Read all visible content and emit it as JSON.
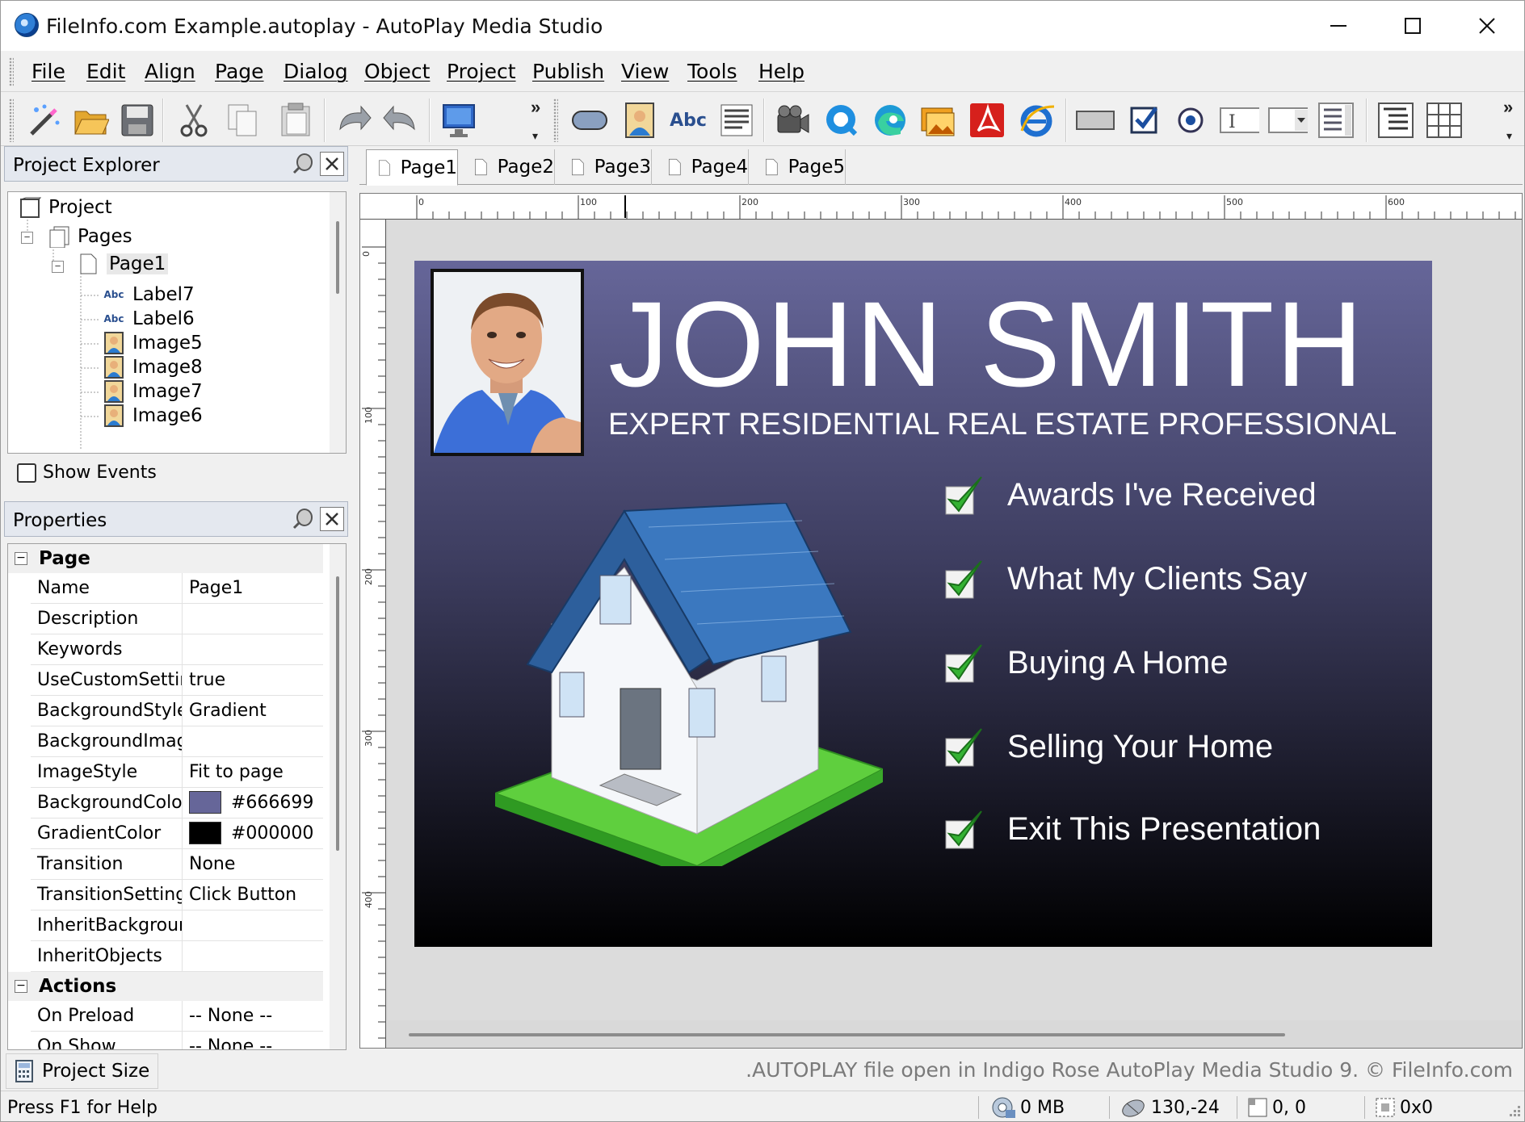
{
  "window": {
    "title": "FileInfo.com Example.autoplay - AutoPlay Media Studio"
  },
  "menu": {
    "items": [
      "File",
      "Edit",
      "Align",
      "Page",
      "Dialog",
      "Object",
      "Project",
      "Publish",
      "View",
      "Tools",
      "Help"
    ]
  },
  "toolbar": {
    "icons": [
      "wizard-icon",
      "open-folder-icon",
      "save-icon",
      "cut-icon",
      "copy-icon",
      "paste-icon",
      "undo-icon",
      "redo-icon",
      "preview-icon",
      "button-object-icon",
      "image-object-icon",
      "label-object-icon",
      "paragraph-object-icon",
      "video-object-icon",
      "quicktime-object-icon",
      "web-object-icon",
      "slideshow-object-icon",
      "pdf-object-icon",
      "flash-object-icon",
      "input-object-icon",
      "checkbox-object-icon",
      "radio-object-icon",
      "textbox-object-icon",
      "combobox-object-icon",
      "listbox-object-icon",
      "tree-object-icon",
      "grid-object-icon"
    ],
    "label_icon_text": "Abc"
  },
  "explorer": {
    "title": "Project Explorer",
    "tree": [
      {
        "label": "Project",
        "icon": "project-icon",
        "level": 0
      },
      {
        "label": "Pages",
        "icon": "pages-icon",
        "level": 1
      },
      {
        "label": "Page1",
        "icon": "page-icon",
        "level": 2
      },
      {
        "label": "Label7",
        "icon": "label-icon",
        "level": 3
      },
      {
        "label": "Label6",
        "icon": "label-icon",
        "level": 3
      },
      {
        "label": "Image5",
        "icon": "image-icon",
        "level": 3
      },
      {
        "label": "Image8",
        "icon": "image-icon",
        "level": 3
      },
      {
        "label": "Image7",
        "icon": "image-icon",
        "level": 3
      },
      {
        "label": "Image6",
        "icon": "image-icon",
        "level": 3
      }
    ],
    "label_icon_text": "Abc",
    "show_events_label": "Show Events",
    "show_events_checked": false
  },
  "properties": {
    "title": "Properties",
    "groups": [
      {
        "name": "Page",
        "rows": [
          {
            "name": "Name",
            "value": "Page1"
          },
          {
            "name": "Description",
            "value": ""
          },
          {
            "name": "Keywords",
            "value": ""
          },
          {
            "name": "UseCustomSettin",
            "value": "true"
          },
          {
            "name": "BackgroundStyle",
            "value": "Gradient"
          },
          {
            "name": "BackgroundImag",
            "value": ""
          },
          {
            "name": "ImageStyle",
            "value": "Fit to page"
          },
          {
            "name": "BackgroundColo",
            "value": "#666699",
            "swatch": "#666699"
          },
          {
            "name": "GradientColor",
            "value": "#000000",
            "swatch": "#000000"
          },
          {
            "name": "Transition",
            "value": "None"
          },
          {
            "name": "TransitionSetting",
            "value": "Click Button"
          },
          {
            "name": "InheritBackgrour",
            "value": ""
          },
          {
            "name": "InheritObjects",
            "value": ""
          }
        ]
      },
      {
        "name": "Actions",
        "rows": [
          {
            "name": "On Preload",
            "value": "-- None --"
          },
          {
            "name": "On Show",
            "value": "-- None --"
          }
        ]
      }
    ]
  },
  "tabs": [
    "Page1",
    "Page2",
    "Page3",
    "Page4",
    "Page5"
  ],
  "active_tab": "Page1",
  "ruler": {
    "h_labels": [
      "0",
      "100",
      "200",
      "300",
      "400",
      "500",
      "600"
    ],
    "v_labels": [
      "0",
      "100",
      "200",
      "300",
      "400"
    ]
  },
  "page": {
    "name": "JOHN SMITH",
    "subtitle": "EXPERT RESIDENTIAL REAL ESTATE PROFESSIONAL",
    "background_color": "#666699",
    "gradient_color": "#000000",
    "links": [
      "Awards I've Received",
      "What My Clients Say",
      "Buying A Home",
      "Selling Your Home",
      "Exit This Presentation"
    ]
  },
  "status": {
    "project_size_label": "Project Size",
    "watermark": ".AUTOPLAY file open in Indigo Rose AutoPlay Media Studio 9. © FileInfo.com",
    "help": "Press F1 for Help",
    "memory": "0 MB",
    "cursor": "130,-24",
    "position": "0, 0",
    "size": "0x0"
  }
}
